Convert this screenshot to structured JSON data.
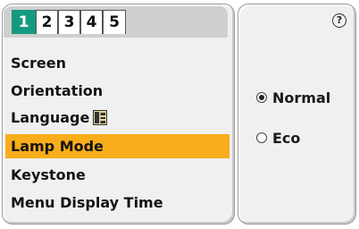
{
  "tabs": [
    {
      "label": "1",
      "active": true
    },
    {
      "label": "2",
      "active": false
    },
    {
      "label": "3",
      "active": false
    },
    {
      "label": "4",
      "active": false
    },
    {
      "label": "5",
      "active": false
    }
  ],
  "menu": {
    "items": [
      {
        "label": "Screen"
      },
      {
        "label": "Orientation"
      },
      {
        "label": "Language",
        "icon": "language-icon"
      },
      {
        "label": "Lamp Mode",
        "selected": true
      },
      {
        "label": "Keystone"
      },
      {
        "label": "Menu Display Time"
      }
    ]
  },
  "options": {
    "help_symbol": "?",
    "lamp_mode": [
      {
        "label": "Normal",
        "checked": true
      },
      {
        "label": "Eco",
        "checked": false
      }
    ]
  },
  "colors": {
    "active_tab": "#159a80",
    "selected_row": "#f8ad1a",
    "panel_bg": "#f0f0f0"
  }
}
